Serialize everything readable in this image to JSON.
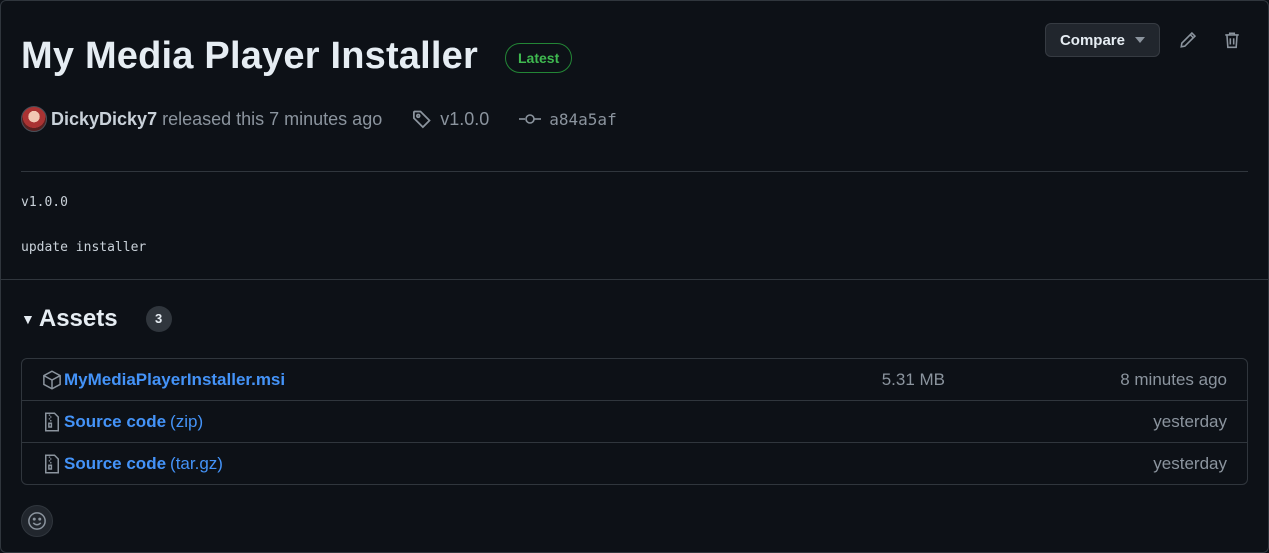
{
  "release": {
    "title": "My Media Player Installer",
    "latest_badge": "Latest",
    "author": "DickyDicky7",
    "released_text": "released this 7 minutes ago",
    "tag": "v1.0.0",
    "commit": "a84a5af"
  },
  "actions": {
    "compare_label": "Compare"
  },
  "notes": {
    "line1": "v1.0.0",
    "line2": "update installer"
  },
  "assets": {
    "title": "Assets",
    "count": "3",
    "items": [
      {
        "name": "MyMediaPlayerInstaller.msi",
        "suffix": "",
        "size": "5.31 MB",
        "time": "8 minutes ago",
        "icon": "package-icon"
      },
      {
        "name": "Source code",
        "suffix": "(zip)",
        "size": "",
        "time": "yesterday",
        "icon": "file-zip-icon"
      },
      {
        "name": "Source code",
        "suffix": "(tar.gz)",
        "size": "",
        "time": "yesterday",
        "icon": "file-zip-icon"
      }
    ]
  },
  "colors": {
    "background": "#0d1117",
    "link": "#4493f8",
    "latest_green": "#3fb950",
    "border": "#30363d"
  }
}
